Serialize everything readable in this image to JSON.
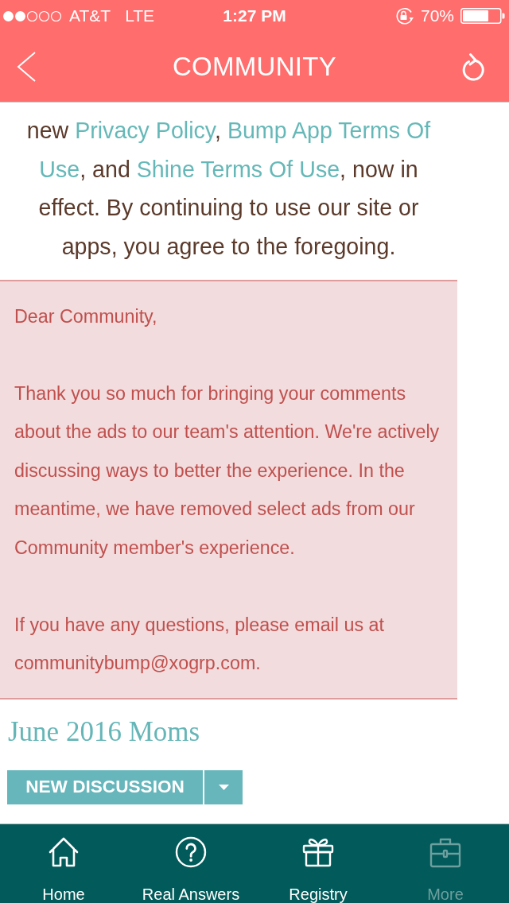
{
  "status_bar": {
    "carrier": "AT&T",
    "network": "LTE",
    "time": "1:27 PM",
    "battery": "70%"
  },
  "nav_bar": {
    "title": "COMMUNITY"
  },
  "intro": {
    "lines": [
      [
        {
          "kind": "text",
          "text": "new "
        },
        {
          "kind": "link",
          "text": "Privacy Policy"
        },
        {
          "kind": "text",
          "text": ", "
        },
        {
          "kind": "link",
          "text": "Bump App Terms Of"
        }
      ],
      [
        {
          "kind": "link",
          "text": "Use"
        },
        {
          "kind": "text",
          "text": ", and "
        },
        {
          "kind": "link",
          "text": "Shine Terms Of Use"
        },
        {
          "kind": "text",
          "text": ", now in"
        }
      ],
      [
        {
          "kind": "text",
          "text": "effect. By continuing to use our site or"
        }
      ],
      [
        {
          "kind": "text",
          "text": "apps, you agree to the foregoing."
        }
      ]
    ]
  },
  "notice": {
    "paragraphs": [
      "Dear Community,",
      "Thank you so much for bringing your comments about the ads to our team's attention. We're actively discussing ways to better the experience. In the meantime, we have removed select ads from our Community member's experience.",
      "If you have any questions, please email us at communitybump@xogrp.com."
    ]
  },
  "group": {
    "title": "June 2016 Moms",
    "button": "NEW DISCUSSION"
  },
  "tab_bar": [
    {
      "label": "Home",
      "selected": false
    },
    {
      "label": "Real Answers",
      "selected": false
    },
    {
      "label": "Registry",
      "selected": false
    },
    {
      "label": "More",
      "selected": true
    }
  ]
}
